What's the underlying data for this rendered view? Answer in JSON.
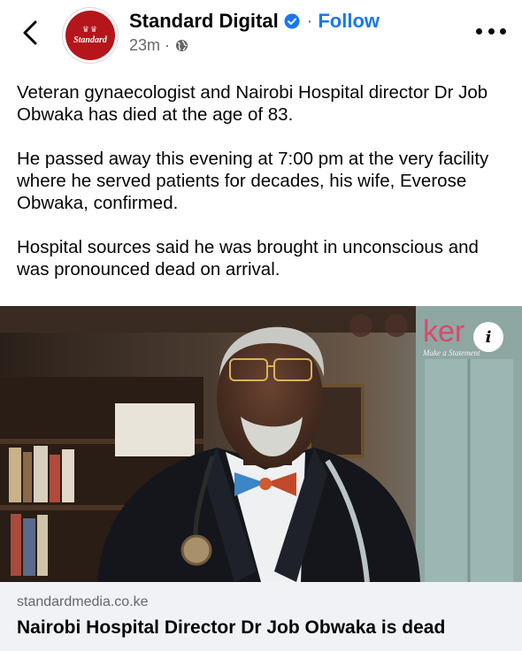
{
  "header": {
    "page_name": "Standard Digital",
    "follow_label": "Follow",
    "separator": "·",
    "timestamp": "23m",
    "meta_separator": "·",
    "avatar_label": "Standard",
    "icons": {
      "back": "chevron-left-icon",
      "verified": "verified-badge-icon",
      "audience": "globe-icon",
      "more": "more-options-icon"
    }
  },
  "post": {
    "paragraphs": [
      "Veteran gynaecologist and Nairobi Hospital director Dr Job Obwaka has died at the age of 83.",
      "He passed away this evening at 7:00 pm at the very facility where he served patients for decades, his wife, Everose Obwaka, confirmed.",
      "Hospital sources said he was brought in unconscious and was pronounced dead on arrival."
    ]
  },
  "link_preview": {
    "watermark": "ker",
    "watermark_sub": "Make a Statement",
    "info_glyph": "i",
    "domain": "standardmedia.co.ke",
    "title": "Nairobi Hospital Director Dr Job Obwaka is dead"
  },
  "colors": {
    "accent": "#1877f2",
    "secondary_text": "#65676b",
    "brand_red": "#b4161b",
    "footer_bg": "#f0f2f5"
  }
}
